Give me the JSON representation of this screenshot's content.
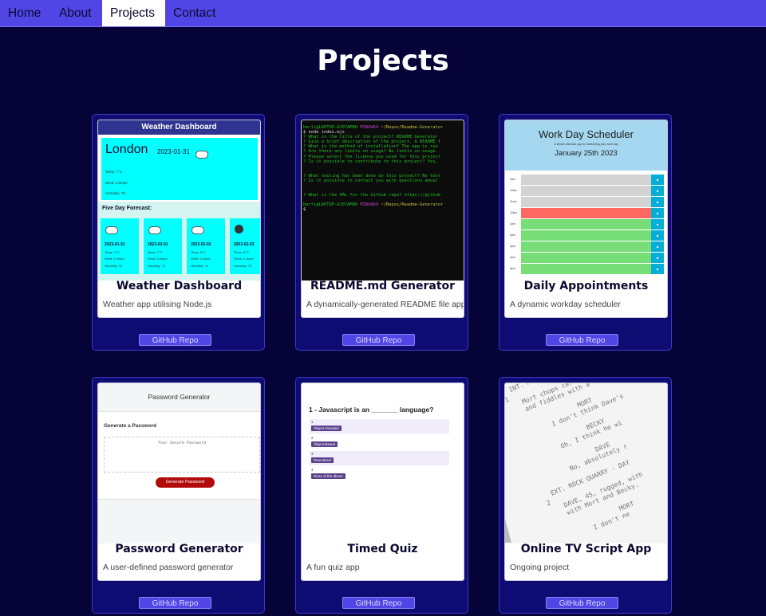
{
  "nav": {
    "items": [
      {
        "label": "Home",
        "active": false
      },
      {
        "label": "About",
        "active": false
      },
      {
        "label": "Projects",
        "active": true
      },
      {
        "label": "Contact",
        "active": false
      }
    ]
  },
  "page_title": "Projects",
  "colors": {
    "background": "#060338",
    "nav": "#4f46e5",
    "card": "#0e0b72",
    "button": "#4f46e5"
  },
  "projects": [
    {
      "title": "Weather Dashboard",
      "description": "Weather app utilising Node.js",
      "button": "GitHub Repo"
    },
    {
      "title": "README.md Generator",
      "description": "A dynamically-generated README file app",
      "button": "GitHub Repo"
    },
    {
      "title": "Daily Appointments",
      "description": "A dynamic workday scheduler",
      "button": "GitHub Repo"
    },
    {
      "title": "Password Generator",
      "description": "A user-defined password generator",
      "button": "GitHub Repo"
    },
    {
      "title": "Timed Quiz",
      "description": "A fun quiz app",
      "button": "GitHub Repo"
    },
    {
      "title": "Online TV Script App",
      "description": "Ongoing project",
      "button": "GitHub Repo"
    }
  ],
  "thumbnails": {
    "weather": {
      "header": "Weather Dashboard",
      "city": "London",
      "date": "2023-01-31",
      "stats": [
        "Temp: 7°C",
        "Wind: 4.9mph",
        "Humidity: 76"
      ],
      "forecast_label": "Five Day Forecast:",
      "forecast_days": [
        {
          "date": "2023-01-31",
          "temp": "Temp: 7°C",
          "wind": "Wind: 4.9mph",
          "humidity": "Humidity: 76"
        },
        {
          "date": "2023-02-01",
          "temp": "Temp: 7°C",
          "wind": "Wind: 5.6mph",
          "humidity": "Humidity: 74"
        },
        {
          "date": "2023-02-02",
          "temp": "Temp: 8°C",
          "wind": "Wind: 5.9mph",
          "humidity": "Humidity: 74"
        },
        {
          "date": "2023-02-03",
          "temp": "Temp: 8°C",
          "wind": "Wind: 6.2mph",
          "humidity": "Humidity: 79"
        }
      ]
    },
    "terminal": {
      "prompt_user": "berti@LAPTOP-AJ07AM9H",
      "prompt_env": "MINGW64",
      "prompt_path": "~/Repos/Readme-Generator",
      "lines": [
        {
          "text": "$ node index.mjs",
          "tone": "w"
        },
        {
          "text": "? What is the title of the project? README Generator",
          "tone": "g"
        },
        {
          "text": "? Give a brief description of the project. A README f",
          "tone": "g"
        },
        {
          "text": "? What is the method of installation? The app is run",
          "tone": "g"
        },
        {
          "text": "? Are there any limits on usage? No limits on usage.",
          "tone": "g"
        },
        {
          "text": "? Please select the license you used for this project",
          "tone": "g"
        },
        {
          "text": "? Is it possible to contribute to this project? Yes,",
          "tone": "g"
        },
        {
          "text": "",
          "tone": "w"
        },
        {
          "text": "? What testing has been done on this project? No test",
          "tone": "g"
        },
        {
          "text": "? Is it possible to contact you with questions about",
          "tone": "g"
        },
        {
          "text": "",
          "tone": "w"
        },
        {
          "text": "? What is the URL for the Github repo? https://github",
          "tone": "g"
        }
      ],
      "cursor": "$"
    },
    "scheduler": {
      "title": "Work Day Scheduler",
      "subtitle": "A simple calendar app for scheduling your work day",
      "date": "January 25th 2023",
      "hours": [
        "9am",
        "10am",
        "11am",
        "12pm",
        "1pm",
        "2pm",
        "3pm",
        "4pm",
        "5pm"
      ],
      "row_status": [
        "past",
        "past",
        "past",
        "present",
        "future",
        "future",
        "future",
        "future",
        "future"
      ],
      "status_colors": {
        "past": "#d3d3d3",
        "present": "#ff6961",
        "future": "#77dd77"
      }
    },
    "password": {
      "header": "Password Generator",
      "subheading": "Generate a Password",
      "placeholder": "Your Secure Password",
      "button": "Generate Password"
    },
    "quiz": {
      "question": "1 - Javascript is an _______ language?",
      "options": [
        {
          "num": "1",
          "label": "Object-Oriented"
        },
        {
          "num": "2",
          "label": "Object-Based"
        },
        {
          "num": "3",
          "label": "Procedural"
        },
        {
          "num": "4",
          "label": "None of the above"
        }
      ]
    },
    "script": {
      "text": "   INT. MORT'S KITCHEN - D\n 1\n     Mort chops carrots at the cou\n     and fiddles with a Rubik's Cube\n\n                  MORT\n          I don't think Dave's\n\n                  BECKY\n          Oh, I think he wi\n\n                  DAVE\n          No, absolutely r\n\n   EXT. ROCK QUARRY - DAY\n 2\n     DAVE, 45, rugged, with\n     with Mort and Becky.\n\n                  MORT\n          I don't ne"
    }
  }
}
